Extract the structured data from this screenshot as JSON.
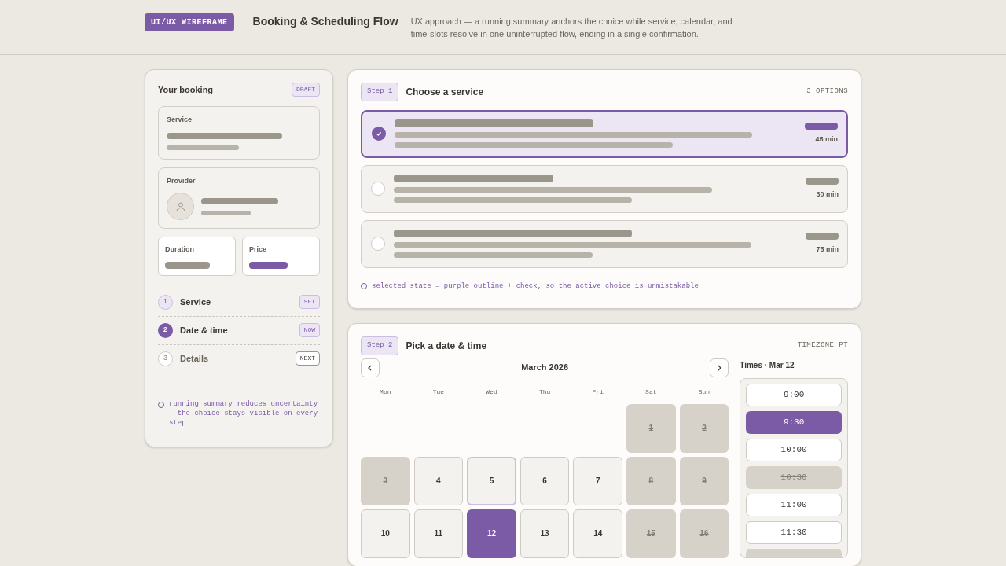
{
  "header": {
    "badge": "UI/UX WIREFRAME",
    "title": "Booking & Scheduling Flow",
    "description": "UX approach — a running summary anchors the choice while service, calendar, and time-slots resolve in one uninterrupted flow, ending in a single confirmation."
  },
  "summary": {
    "title": "Your booking",
    "badge": "DRAFT",
    "service_label": "Service",
    "provider_label": "Provider",
    "duration_label": "Duration",
    "price_label": "Price",
    "steps": [
      {
        "number": "1",
        "label": "Service",
        "tag": "SET",
        "kind": "done"
      },
      {
        "number": "2",
        "label": "Date & time",
        "tag": "NOW",
        "kind": "current"
      },
      {
        "number": "3",
        "label": "Details",
        "tag": "NEXT",
        "kind": "next"
      }
    ],
    "note": "running summary reduces uncertainty — the choice stays visible on every step"
  },
  "service_step": {
    "step": "Step 1",
    "title": "Choose a service",
    "count": "3 OPTIONS",
    "options": [
      {
        "selected": true,
        "duration": "45 min"
      },
      {
        "selected": false,
        "duration": "30 min"
      },
      {
        "selected": false,
        "duration": "75 min"
      }
    ],
    "note": "selected state = purple outline + check, so the active choice is unmistakable"
  },
  "date_step": {
    "step": "Step 2",
    "title": "Pick a date & time",
    "timezone": "TIMEZONE PT",
    "month": "March 2026",
    "weekdays": [
      "Mon",
      "Tue",
      "Wed",
      "Thu",
      "Fri",
      "Sat",
      "Sun"
    ],
    "days": [
      {
        "kind": "blank"
      },
      {
        "kind": "blank"
      },
      {
        "kind": "blank"
      },
      {
        "kind": "blank"
      },
      {
        "kind": "blank"
      },
      {
        "kind": "unavailable",
        "label": "1"
      },
      {
        "kind": "unavailable",
        "label": "2"
      },
      {
        "kind": "unavailable",
        "label": "3"
      },
      {
        "kind": "available",
        "label": "4"
      },
      {
        "kind": "today",
        "label": "5"
      },
      {
        "kind": "available",
        "label": "6"
      },
      {
        "kind": "available",
        "label": "7"
      },
      {
        "kind": "unavailable",
        "label": "8"
      },
      {
        "kind": "unavailable",
        "label": "9"
      },
      {
        "kind": "available",
        "label": "10"
      },
      {
        "kind": "available",
        "label": "11"
      },
      {
        "kind": "selected",
        "label": "12"
      },
      {
        "kind": "available",
        "label": "13"
      },
      {
        "kind": "available",
        "label": "14"
      },
      {
        "kind": "unavailable",
        "label": "15"
      },
      {
        "kind": "unavailable",
        "label": "16"
      }
    ],
    "times_title": "Times · Mar 12",
    "slots": [
      {
        "label": "9:00",
        "kind": "available"
      },
      {
        "label": "9:30",
        "kind": "selected"
      },
      {
        "label": "10:00",
        "kind": "available"
      },
      {
        "label": "10:30",
        "kind": "unavailable"
      },
      {
        "label": "11:00",
        "kind": "available"
      },
      {
        "label": "11:30",
        "kind": "available"
      },
      {
        "kind": "unavailable"
      }
    ]
  }
}
